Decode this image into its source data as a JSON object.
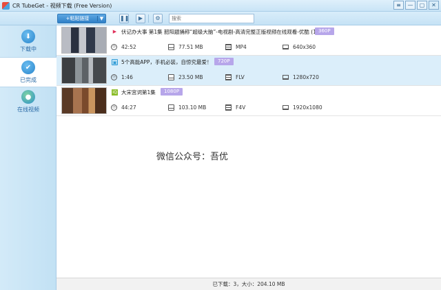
{
  "window": {
    "title": "CR TubeGet - 视频下载 (Free Version)",
    "controls": [
      "≡",
      "—",
      "▢",
      "✕"
    ]
  },
  "toolbar": {
    "paste_label": "+粘贴链接",
    "dropdown_arrow": "▼",
    "icons": [
      "pause-all-icon",
      "resume-all-icon",
      "settings-icon"
    ],
    "search_placeholder": "搜索"
  },
  "sidebar": {
    "items": [
      {
        "label": "下载中",
        "icon": "download-icon",
        "glyph": "⬇"
      },
      {
        "label": "已完成",
        "icon": "check-icon",
        "glyph": "✔"
      },
      {
        "label": "在线视频",
        "icon": "globe-icon",
        "glyph": "●"
      }
    ]
  },
  "videos": [
    {
      "title": "伏记办大事 第1集 韶阳题捅称“超级大脑”-电视剧-高清完整正版视频在线观看-优酷 (1)",
      "quality": "360P",
      "source_icon": "youku-icon",
      "source_glyph": "▶",
      "duration": "42:52",
      "size": "77.51 MB",
      "format": "MP4",
      "resolution": "640x360"
    },
    {
      "title": "5个高能APP，手机必装，自惊究最爱！",
      "quality": "720P",
      "source_icon": "bilibili-icon",
      "source_glyph": "▣",
      "duration": "1:46",
      "size": "23.50 MB",
      "format": "FLV",
      "resolution": "1280x720"
    },
    {
      "title": "大宋宫词第1集",
      "quality": "1080P",
      "source_icon": "iqiyi-icon",
      "source_glyph": "iQ",
      "duration": "44:27",
      "size": "103.10 MB",
      "format": "F4V",
      "resolution": "1920x1080"
    }
  ],
  "watermark": "微信公众号：吾优",
  "status": "已下载：3，大小：204.10 MB"
}
